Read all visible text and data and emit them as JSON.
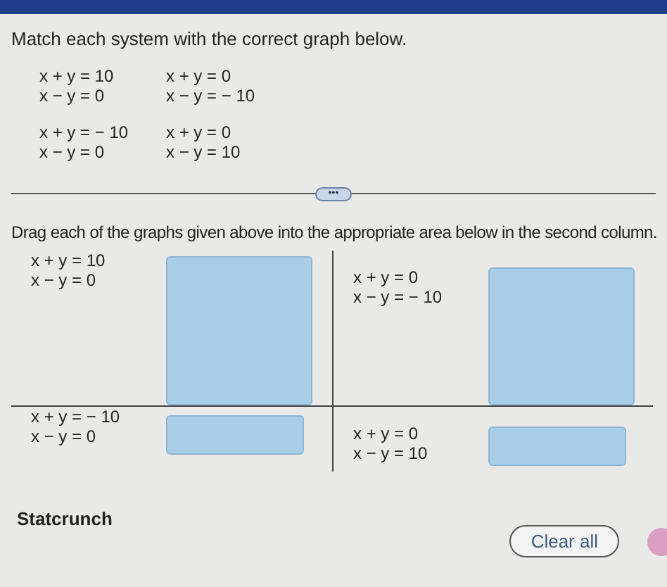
{
  "instruction": "Match each system with the correct graph below.",
  "systems": [
    {
      "equations": [
        "x + y = 10",
        "x − y = 0"
      ]
    },
    {
      "equations": [
        "x + y = 0",
        "x − y = − 10"
      ]
    },
    {
      "equations": [
        "x + y = − 10",
        "x − y = 0"
      ]
    },
    {
      "equations": [
        "x + y = 0",
        "x − y = 10"
      ]
    }
  ],
  "divider_handle": "•••",
  "drag_instruction": "Drag each of the graphs given above into the appropriate area below in the second column.",
  "match_rows": [
    {
      "equations": [
        "x + y = 10",
        "x − y = 0"
      ]
    },
    {
      "equations": [
        "x + y = 0",
        "x − y = − 10"
      ]
    },
    {
      "equations": [
        "x + y = − 10",
        "x − y = 0"
      ]
    },
    {
      "equations": [
        "x + y = 0",
        "x − y = 10"
      ]
    }
  ],
  "footer": {
    "label": "Statcrunch",
    "button": "Clear all"
  }
}
